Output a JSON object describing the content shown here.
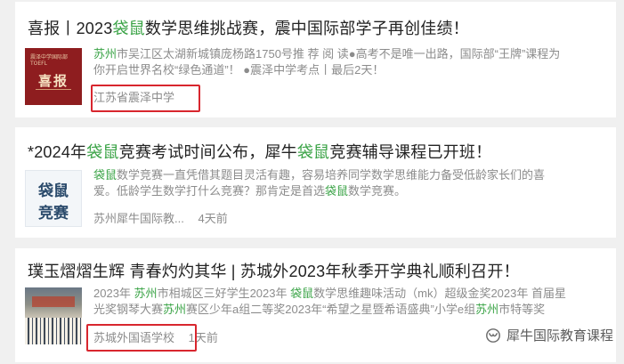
{
  "articles": [
    {
      "title_parts": [
        "喜报丨2023",
        "袋鼠",
        "数学思维挑战赛，震中国际部学子再创佳绩！"
      ],
      "thumb": {
        "main_text": "喜报",
        "small_text": "震泽中学国际部 TOEFL"
      },
      "snippet": {
        "line1_parts": [
          "苏州",
          "市吴江区太湖新城镇庞杨路1750号推 荐 阅 读●高考不是唯一出路，国际部“王牌”课程为"
        ],
        "line2": "你开启世界名校“绿色通道”！ ●震泽中学考点丨最后2天！"
      },
      "source": "江苏省震泽中学",
      "time": ""
    },
    {
      "title_parts": [
        "*2024年",
        "袋鼠",
        "竞赛考试时间公布，犀牛",
        "袋鼠",
        "竞赛辅导课程已开班！"
      ],
      "thumb": {
        "line1": "袋鼠",
        "line2": "竞赛"
      },
      "snippet": {
        "line1_parts": [
          "袋鼠",
          "数学竞赛一直凭借其题目灵活有趣，容易培养同学数学思维能力备受低龄家长们的喜"
        ],
        "line2_parts": [
          "爱。低龄学生数学打什么竞赛？那肯定是首选",
          "袋鼠",
          "数学竞赛。"
        ]
      },
      "source": "苏州犀牛国际教...",
      "time": "4天前"
    },
    {
      "title": "璞玉熠熠生辉 青春灼灼其华 | 苏城外2023年秋季开学典礼顺利召开！",
      "snippet": {
        "line1_parts": [
          "2023年 ",
          "苏州",
          "市相城区三好学生2023年 ",
          "袋鼠",
          "数学思维趣味活动（mk）超级金奖2023年 首届星"
        ],
        "line2_parts": [
          "光奖钢琴大赛",
          "苏州",
          "赛区少年a组二等奖2023年“希望之星暨希语盛典”小学e组",
          "苏州",
          "市特等奖"
        ]
      },
      "source": "苏城外国语学校",
      "time": "1天前"
    }
  ],
  "watermark": {
    "text": "犀牛国际教育课程",
    "icon": "wechat-channel-icon"
  },
  "colors": {
    "highlight": "#3aa346",
    "redbox": "#d8262e",
    "snippet": "#8c8c8c",
    "title": "#222222"
  }
}
